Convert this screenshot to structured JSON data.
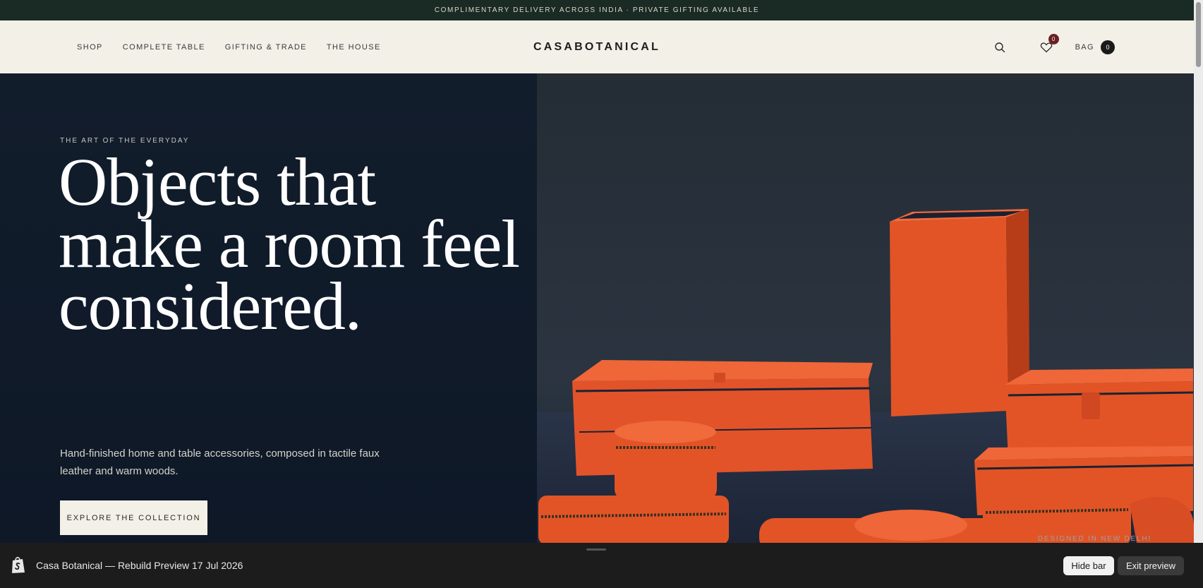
{
  "announcement": {
    "text": "COMPLIMENTARY DELIVERY ACROSS INDIA · PRIVATE GIFTING AVAILABLE"
  },
  "header": {
    "nav": [
      {
        "label": "SHOP"
      },
      {
        "label": "COMPLETE TABLE"
      },
      {
        "label": "GIFTING & TRADE"
      },
      {
        "label": "THE HOUSE"
      }
    ],
    "logo": "CASABOTANICAL",
    "search_icon": "search-icon",
    "wishlist_icon": "heart-icon",
    "wishlist_count": "0",
    "bag_label": "BAG",
    "bag_count": "0"
  },
  "hero": {
    "eyebrow": "THE ART OF THE EVERYDAY",
    "headline": "Objects that make a room feel considered.",
    "subcopy": "Hand-finished home and table accessories, composed in tactile faux leather and warm woods.",
    "cta": "EXPLORE THE COLLECTION",
    "image_caption": "DESIGNED IN NEW DELHI"
  },
  "preview_bar": {
    "icon": "shopify-bag-icon",
    "title": "Casa Botanical — Rebuild Preview 17 Jul 2026",
    "hide_label": "Hide bar",
    "exit_label": "Exit preview"
  },
  "colors": {
    "announcement_bg": "#1a2a24",
    "header_bg": "#f3f0e8",
    "hero_bg": "#0f1a2a",
    "product_orange": "#e8552a",
    "wishlist_badge": "#6b1f25"
  }
}
